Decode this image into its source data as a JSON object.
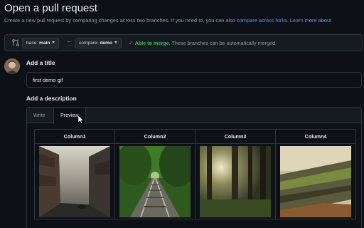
{
  "page": {
    "title": "Open a pull request",
    "subtitle_text": "Create a new pull request by comparing changes across two branches. If you need to, you can also ",
    "subtitle_link_forks": "compare across forks.",
    "subtitle_link_learn": "Learn more about"
  },
  "compare": {
    "base_prefix": "base: ",
    "base_branch": "main",
    "compare_prefix": "compare: ",
    "compare_branch": "demo",
    "status_check": "✓",
    "status_ok": "Able to merge.",
    "status_text": "These branches can be automatically merged."
  },
  "form": {
    "title_label": "Add a title",
    "title_value": "first demo gif",
    "description_label": "Add a description",
    "tabs": [
      {
        "label": "Write"
      },
      {
        "label": "Preview"
      }
    ],
    "active_tab": "Preview"
  },
  "preview_table": {
    "headers": [
      "Column1",
      "Column2",
      "Column3",
      "Column4"
    ]
  },
  "colors": {
    "background": "#0d1117",
    "link": "#4493f8",
    "success": "#3fb950",
    "border": "#30363d"
  }
}
